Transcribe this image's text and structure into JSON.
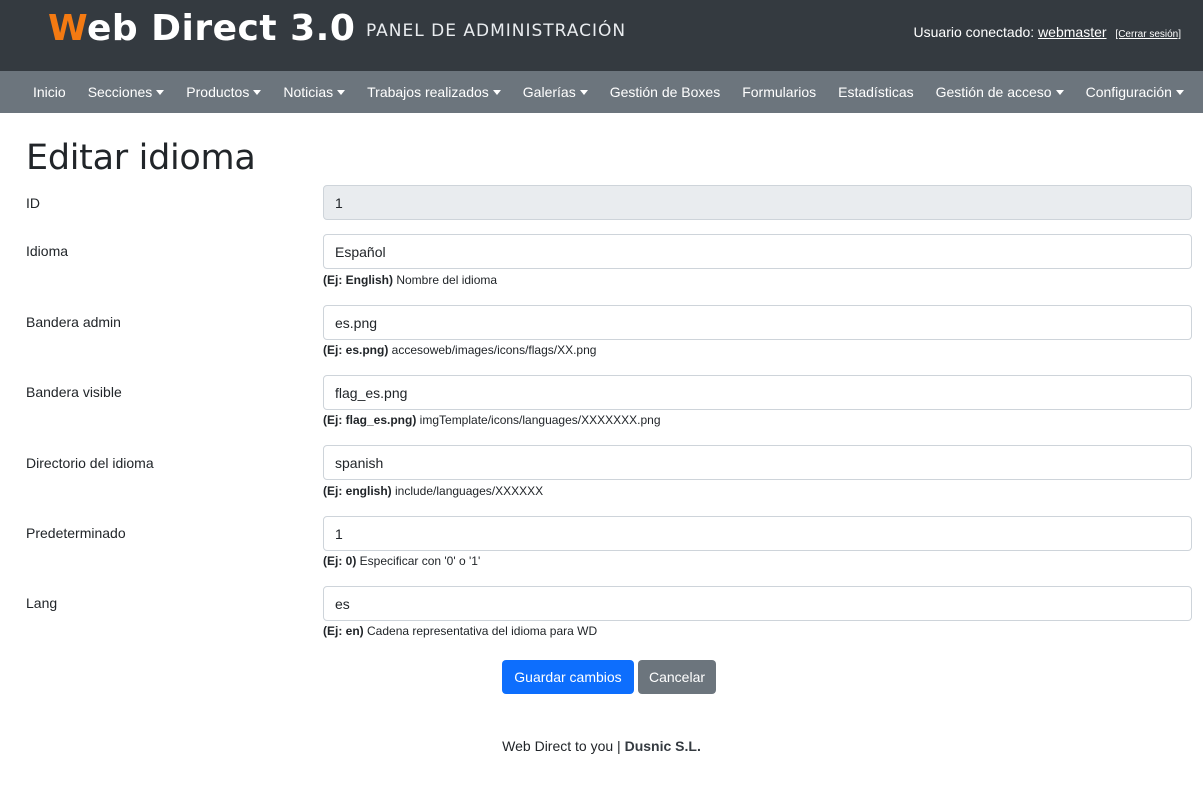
{
  "header": {
    "brand_initial": "W",
    "brand_rest": "eb Direct 3.0",
    "panel_title": "PANEL DE ADMINISTRACIÓN",
    "user_label": "Usuario conectado:",
    "username": "webmaster",
    "logout": "[Cerrar sesión]"
  },
  "nav": {
    "items": [
      {
        "label": "Inicio",
        "dropdown": false
      },
      {
        "label": "Secciones",
        "dropdown": true
      },
      {
        "label": "Productos",
        "dropdown": true
      },
      {
        "label": "Noticias",
        "dropdown": true
      },
      {
        "label": "Trabajos realizados",
        "dropdown": true
      },
      {
        "label": "Galerías",
        "dropdown": true
      },
      {
        "label": "Gestión de Boxes",
        "dropdown": false
      },
      {
        "label": "Formularios",
        "dropdown": false
      },
      {
        "label": "Estadísticas",
        "dropdown": false
      },
      {
        "label": "Gestión de acceso",
        "dropdown": true
      },
      {
        "label": "Configuración",
        "dropdown": true
      }
    ]
  },
  "page": {
    "title": "Editar idioma"
  },
  "form": {
    "fields": [
      {
        "label": "ID",
        "value": "1",
        "readonly": true,
        "help_example": "",
        "help_text": ""
      },
      {
        "label": "Idioma",
        "value": "Español",
        "readonly": false,
        "help_example": "(Ej: English)",
        "help_text": " Nombre del idioma"
      },
      {
        "label": "Bandera admin",
        "value": "es.png",
        "readonly": false,
        "help_example": "(Ej: es.png)",
        "help_text": " accesoweb/images/icons/flags/XX.png"
      },
      {
        "label": "Bandera visible",
        "value": "flag_es.png",
        "readonly": false,
        "help_example": "(Ej: flag_es.png)",
        "help_text": " imgTemplate/icons/languages/XXXXXXX.png"
      },
      {
        "label": "Directorio del idioma",
        "value": "spanish",
        "readonly": false,
        "help_example": "(Ej: english)",
        "help_text": " include/languages/XXXXXX"
      },
      {
        "label": "Predeterminado",
        "value": "1",
        "readonly": false,
        "help_example": "(Ej: 0)",
        "help_text": " Especificar con '0' o '1'"
      },
      {
        "label": "Lang",
        "value": "es",
        "readonly": false,
        "help_example": "(Ej: en)",
        "help_text": " Cadena representativa del idioma para WD"
      }
    ],
    "save_label": "Guardar cambios",
    "cancel_label": "Cancelar"
  },
  "footer": {
    "text": "Web Direct to you | ",
    "company": "Dusnic S.L."
  },
  "colors": {
    "header_bg": "#343a40",
    "nav_bg": "#6c757d",
    "brand_accent": "#f47a12",
    "primary": "#0d6efd",
    "secondary": "#6c757d"
  }
}
